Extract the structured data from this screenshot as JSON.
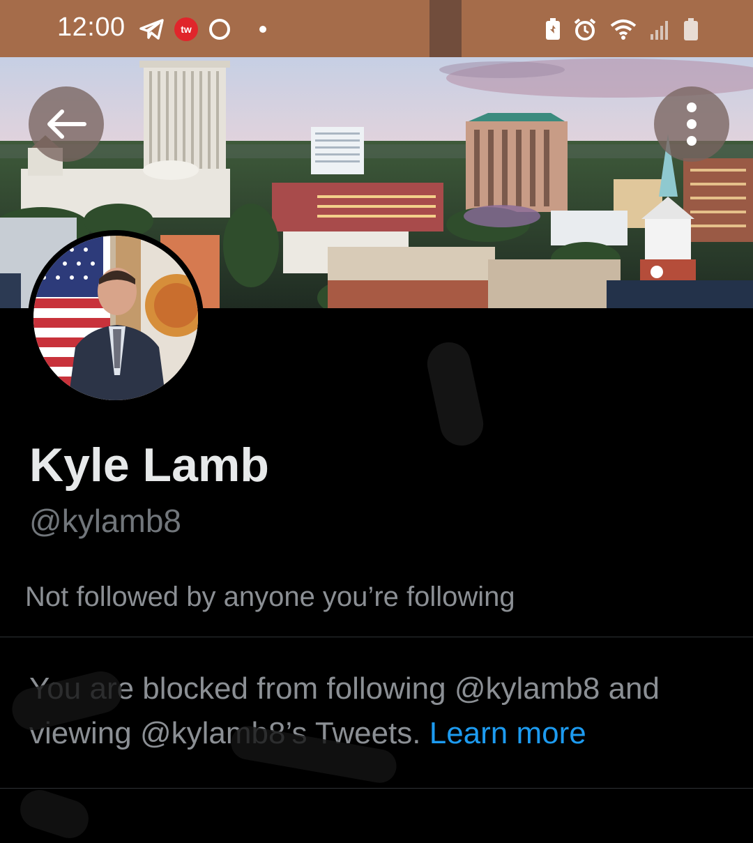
{
  "status_bar": {
    "time": "12:00",
    "left_icons": [
      "telegram-icon",
      "tw-badge",
      "circle-icon",
      "dot"
    ],
    "right_icons": [
      "battery-saver-icon",
      "alarm-icon",
      "wifi-icon",
      "signal-icon",
      "battery-icon"
    ],
    "tw_badge_text": "tw",
    "color": "#a56c4a"
  },
  "header": {
    "back_icon": "arrow-left-icon",
    "more_icon": "more-vertical-icon"
  },
  "profile": {
    "name": "Kyle Lamb",
    "handle": "@kylamb8",
    "followers_note": "Not followed by anyone you’re following",
    "blocked_message": "You are blocked from following @kylamb8 and viewing @kylamb8’s Tweets.",
    "learn_more": "Learn more"
  },
  "colors": {
    "background": "#000000",
    "primary_text": "#e7e9ea",
    "secondary_text": "#71767b",
    "link": "#1d9bf0",
    "divider": "#2f3336"
  }
}
